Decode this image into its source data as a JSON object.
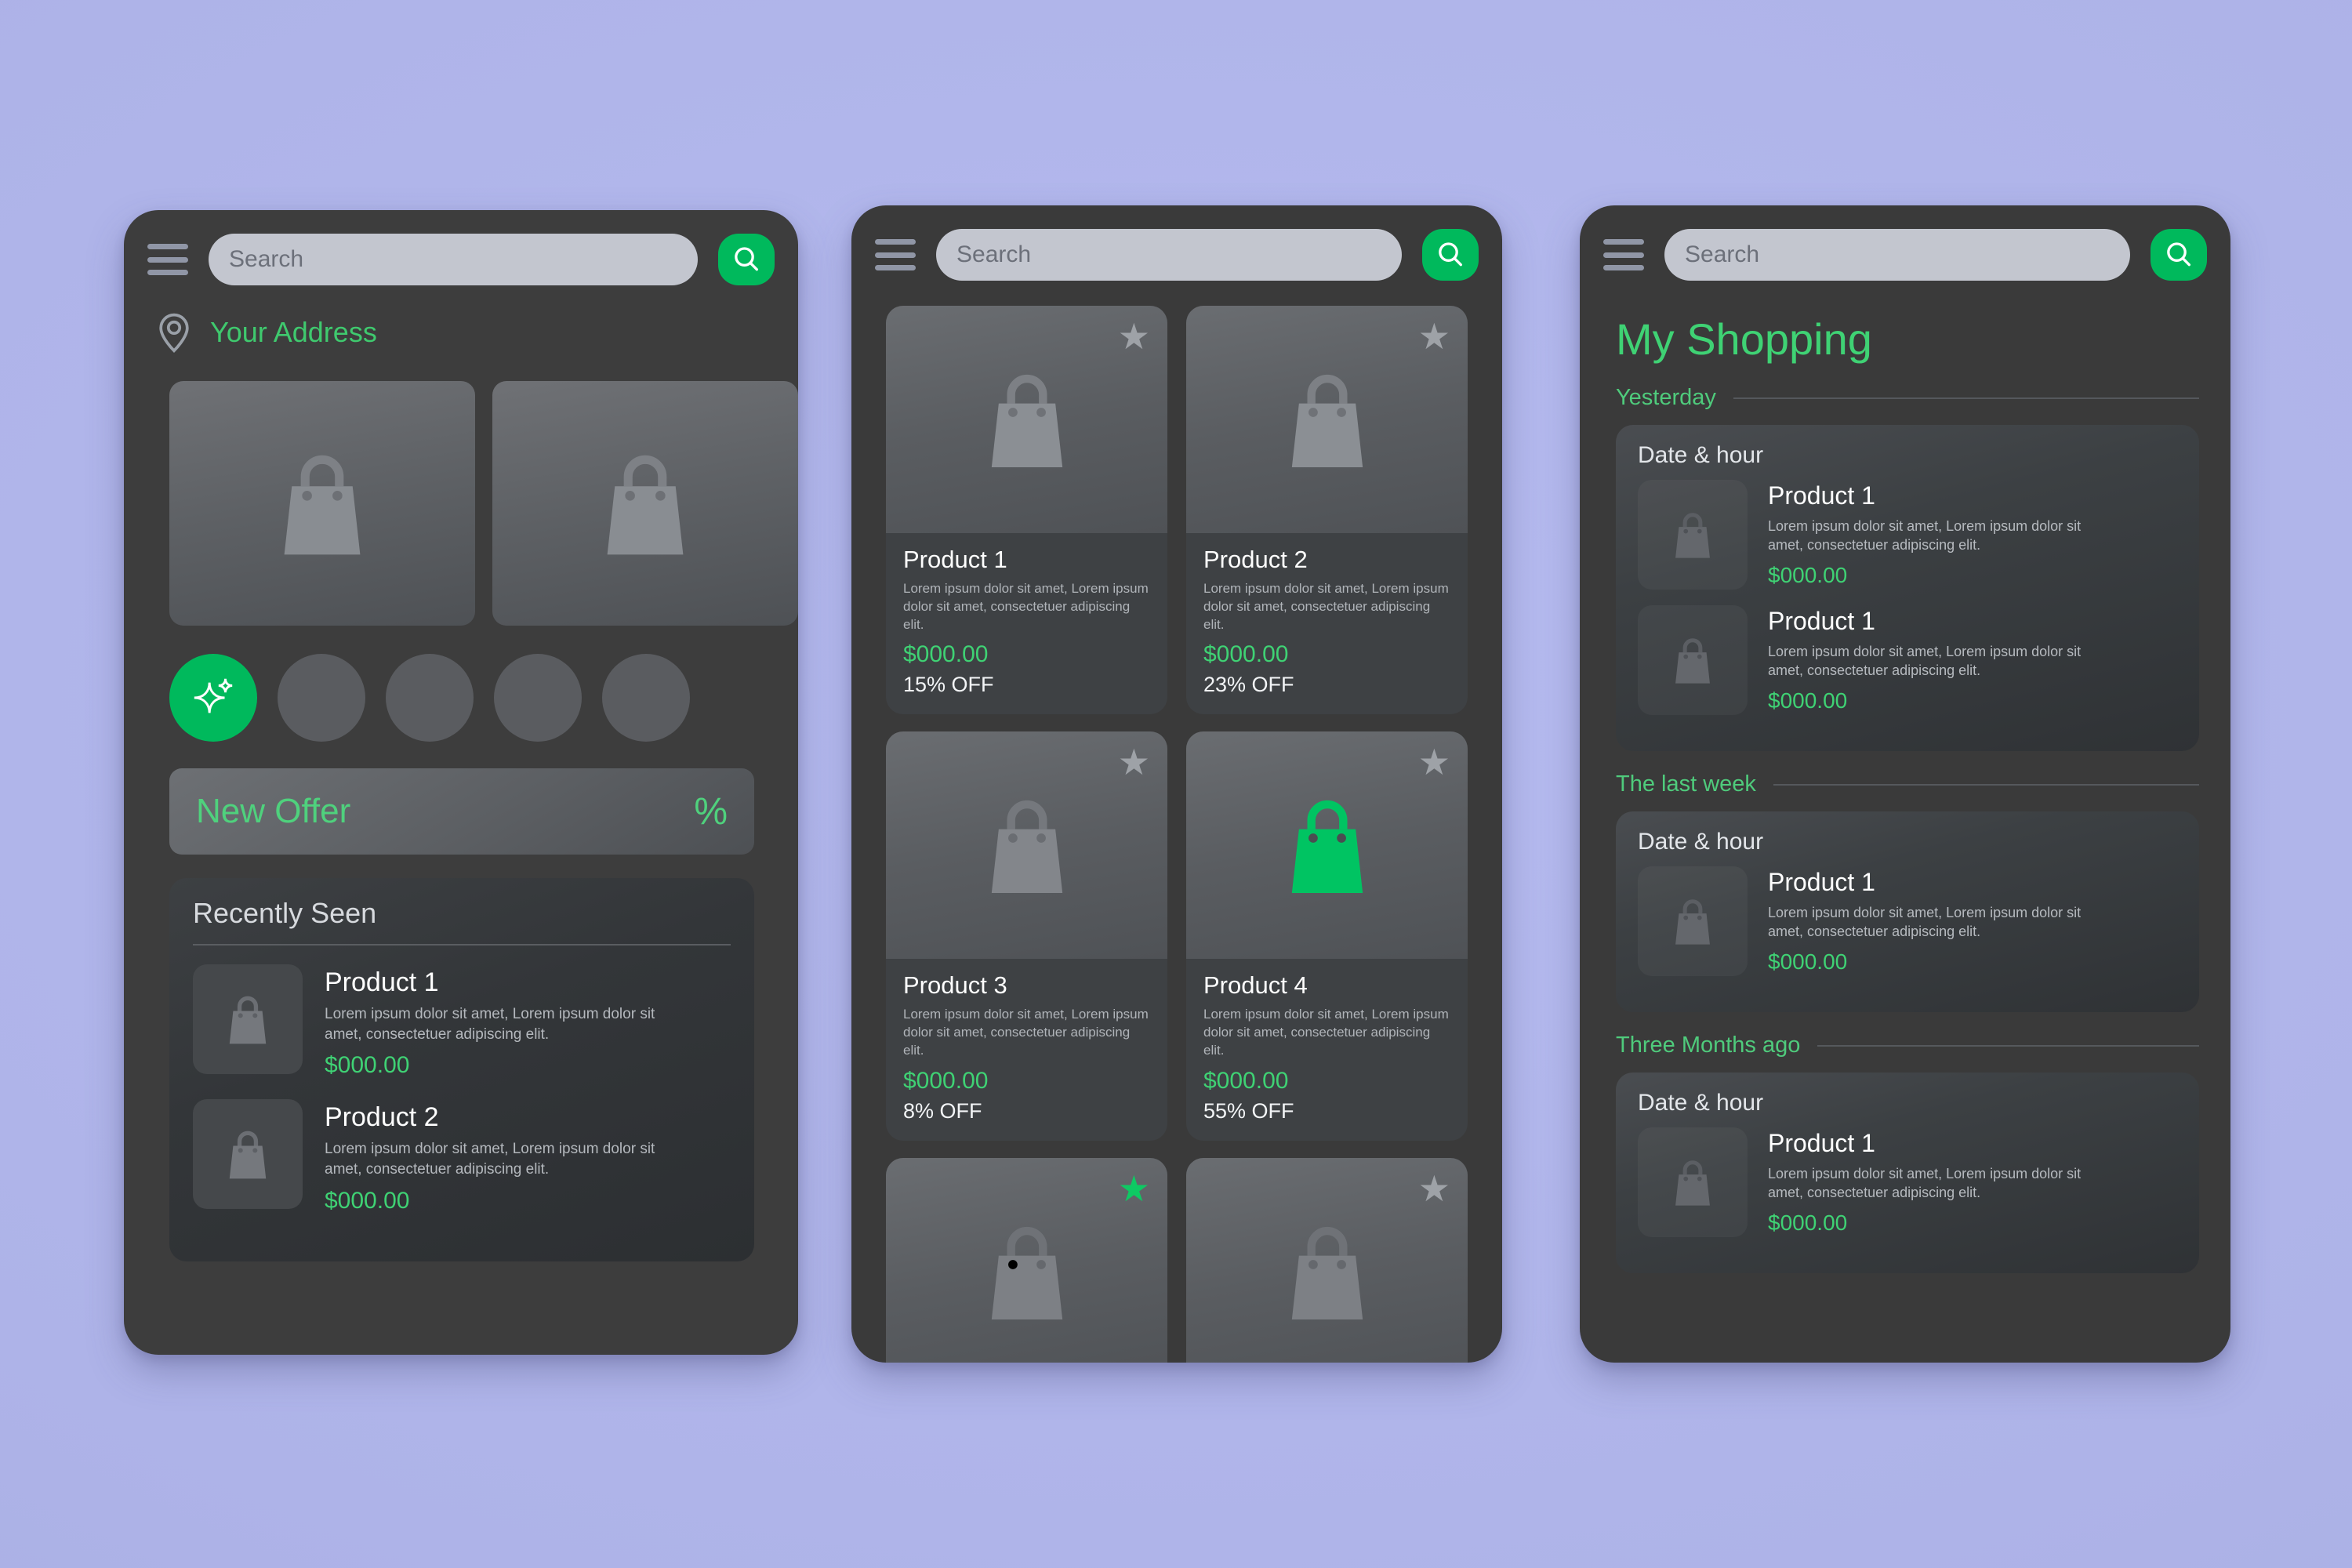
{
  "colors": {
    "page_background": "#aeb3e8",
    "accent_green": "#00b95c",
    "price_green": "#3fd274",
    "phone_surface": "#3d3d3d",
    "search_field": "#c3c6cf"
  },
  "common": {
    "search_placeholder": "Search",
    "menu_icon": "hamburger-menu-icon",
    "search_icon": "search-icon",
    "bag_icon": "shopping-bag-icon",
    "star_icon": "star-icon"
  },
  "screen_home": {
    "search": {
      "placeholder": "Search"
    },
    "address": {
      "icon": "location-pin-icon",
      "label": "Your Address"
    },
    "banners": [
      {
        "image": "shopping-bag-icon"
      },
      {
        "image": "shopping-bag-icon"
      }
    ],
    "categories": [
      {
        "name": "sparkle",
        "active": true
      },
      {
        "name": "category-2",
        "active": false
      },
      {
        "name": "category-3",
        "active": false
      },
      {
        "name": "category-4",
        "active": false
      },
      {
        "name": "category-5",
        "active": false
      }
    ],
    "offer": {
      "title": "New Offer",
      "badge": "%"
    },
    "recently_seen": {
      "heading": "Recently Seen",
      "items": [
        {
          "name": "Product 1",
          "desc": "Lorem ipsum dolor sit amet, Lorem ipsum dolor sit amet, consectetuer adipiscing elit.",
          "price": "$000.00"
        },
        {
          "name": "Product 2",
          "desc": "Lorem ipsum dolor sit amet, Lorem ipsum dolor sit amet, consectetuer adipiscing elit.",
          "price": "$000.00"
        }
      ]
    }
  },
  "screen_catalog": {
    "search": {
      "placeholder": "Search"
    },
    "products": [
      {
        "name": "Product 1",
        "desc": "Lorem ipsum dolor sit amet, Lorem ipsum dolor sit amet, consectetuer adipiscing elit.",
        "price": "$000.00",
        "discount": "15% OFF",
        "favorite": false,
        "bag_highlight": false
      },
      {
        "name": "Product 2",
        "desc": "Lorem ipsum dolor sit amet, Lorem ipsum dolor sit amet, consectetuer adipiscing elit.",
        "price": "$000.00",
        "discount": "23% OFF",
        "favorite": false,
        "bag_highlight": false
      },
      {
        "name": "Product 3",
        "desc": "Lorem ipsum dolor sit amet, Lorem ipsum dolor sit amet, consectetuer adipiscing elit.",
        "price": "$000.00",
        "discount": "8% OFF",
        "favorite": false,
        "bag_highlight": false
      },
      {
        "name": "Product 4",
        "desc": "Lorem ipsum dolor sit amet, Lorem ipsum dolor sit amet, consectetuer adipiscing elit.",
        "price": "$000.00",
        "discount": "55% OFF",
        "favorite": false,
        "bag_highlight": true
      },
      {
        "name": "",
        "desc": "",
        "price": "",
        "discount": "",
        "favorite": true,
        "bag_highlight": false
      },
      {
        "name": "",
        "desc": "",
        "price": "",
        "discount": "",
        "favorite": false,
        "bag_highlight": false
      }
    ]
  },
  "screen_shopping": {
    "search": {
      "placeholder": "Search"
    },
    "title": "My Shopping",
    "sections": [
      {
        "label": "Yesterday",
        "cards": [
          {
            "date": "Date & hour",
            "items": [
              {
                "name": "Product 1",
                "desc": "Lorem ipsum dolor sit amet, Lorem ipsum dolor sit amet, consectetuer adipiscing elit.",
                "price": "$000.00"
              },
              {
                "name": "Product 1",
                "desc": "Lorem ipsum dolor sit amet, Lorem ipsum dolor sit amet, consectetuer adipiscing elit.",
                "price": "$000.00"
              }
            ]
          }
        ]
      },
      {
        "label": "The last week",
        "cards": [
          {
            "date": "Date & hour",
            "items": [
              {
                "name": "Product 1",
                "desc": "Lorem ipsum dolor sit amet, Lorem ipsum dolor sit amet, consectetuer adipiscing elit.",
                "price": "$000.00"
              }
            ]
          }
        ]
      },
      {
        "label": "Three Months ago",
        "cards": [
          {
            "date": "Date & hour",
            "items": [
              {
                "name": "Product 1",
                "desc": "Lorem ipsum dolor sit amet, Lorem ipsum dolor sit amet, consectetuer adipiscing elit.",
                "price": "$000.00"
              }
            ]
          }
        ]
      }
    ]
  }
}
